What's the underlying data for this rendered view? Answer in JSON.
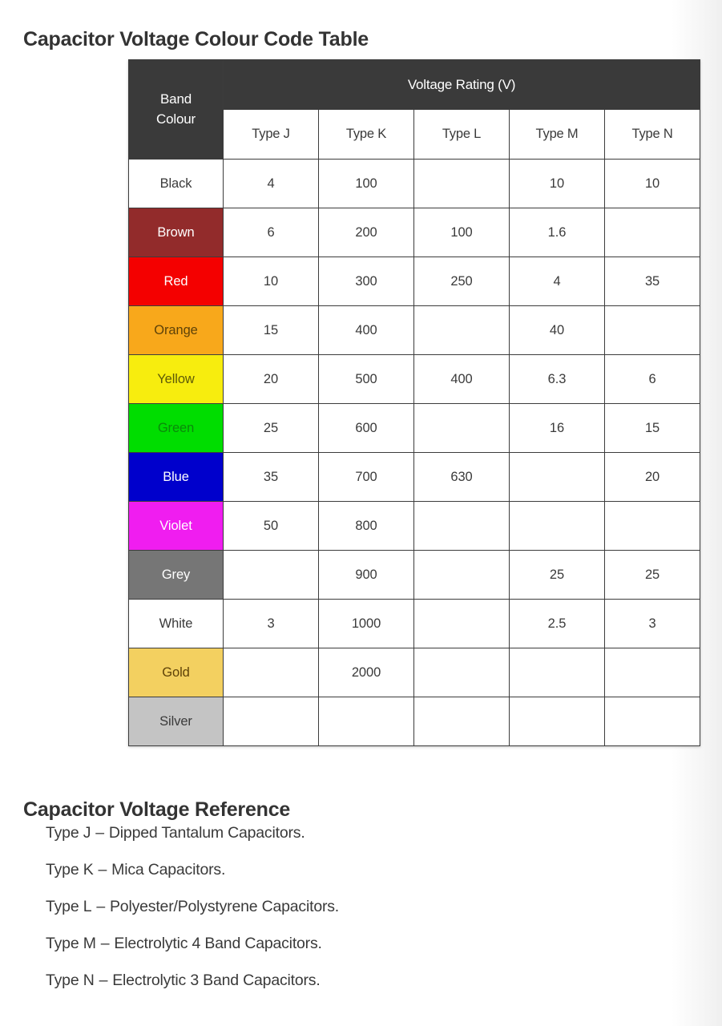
{
  "page": {
    "title": "Capacitor Voltage Colour Code Table",
    "reference_title": "Capacitor Voltage Reference"
  },
  "table": {
    "band_header": "Band\nColour",
    "band_header_line1": "Band",
    "band_header_line2": "Colour",
    "group_header": "Voltage Rating (V)",
    "type_headers": [
      "Type J",
      "Type K",
      "Type L",
      "Type M",
      "Type N"
    ],
    "rows": [
      {
        "colour": "Black",
        "bg": "#ffffff",
        "fg": "#3a3a3a",
        "values": [
          "4",
          "100",
          "",
          "10",
          "10"
        ]
      },
      {
        "colour": "Brown",
        "bg": "#922b2b",
        "fg": "#ffffff",
        "values": [
          "6",
          "200",
          "100",
          "1.6",
          ""
        ]
      },
      {
        "colour": "Red",
        "bg": "#f40000",
        "fg": "#ffffff",
        "values": [
          "10",
          "300",
          "250",
          "4",
          "35"
        ]
      },
      {
        "colour": "Orange",
        "bg": "#f8a81b",
        "fg": "#5e4208",
        "values": [
          "15",
          "400",
          "",
          "40",
          ""
        ]
      },
      {
        "colour": "Yellow",
        "bg": "#f7ed0e",
        "fg": "#5e5a08",
        "values": [
          "20",
          "500",
          "400",
          "6.3",
          "6"
        ]
      },
      {
        "colour": "Green",
        "bg": "#00dd00",
        "fg": "#0a8a0a",
        "values": [
          "25",
          "600",
          "",
          "16",
          "15"
        ]
      },
      {
        "colour": "Blue",
        "bg": "#0000cc",
        "fg": "#ffffff",
        "values": [
          "35",
          "700",
          "630",
          "",
          "20"
        ]
      },
      {
        "colour": "Violet",
        "bg": "#f01df0",
        "fg": "#ffffff",
        "values": [
          "50",
          "800",
          "",
          "",
          ""
        ]
      },
      {
        "colour": "Grey",
        "bg": "#767676",
        "fg": "#ffffff",
        "values": [
          "",
          "900",
          "",
          "25",
          "25"
        ]
      },
      {
        "colour": "White",
        "bg": "#ffffff",
        "fg": "#3a3a3a",
        "values": [
          "3",
          "1000",
          "",
          "2.5",
          "3"
        ]
      },
      {
        "colour": "Gold",
        "bg": "#f3d060",
        "fg": "#5e4208",
        "values": [
          "",
          "2000",
          "",
          "",
          ""
        ]
      },
      {
        "colour": "Silver",
        "bg": "#c4c4c4",
        "fg": "#3a3a3a",
        "values": [
          "",
          "",
          "",
          "",
          ""
        ]
      }
    ]
  },
  "reference": {
    "items": [
      {
        "type": "Type J",
        "dash": "–",
        "description": "Dipped Tantalum Capacitors."
      },
      {
        "type": "Type K",
        "dash": "–",
        "description": "Mica Capacitors."
      },
      {
        "type": "Type L",
        "dash": "–",
        "description": "Polyester/Polystyrene Capacitors."
      },
      {
        "type": "Type M",
        "dash": "–",
        "description": "Electrolytic 4 Band Capacitors."
      },
      {
        "type": "Type N",
        "dash": "–",
        "description": "Electrolytic 3 Band Capacitors."
      }
    ]
  },
  "colors": {
    "header_dark": "#3a3a3a",
    "border": "#3c3c3c",
    "text": "#333333",
    "background": "#ffffff"
  }
}
